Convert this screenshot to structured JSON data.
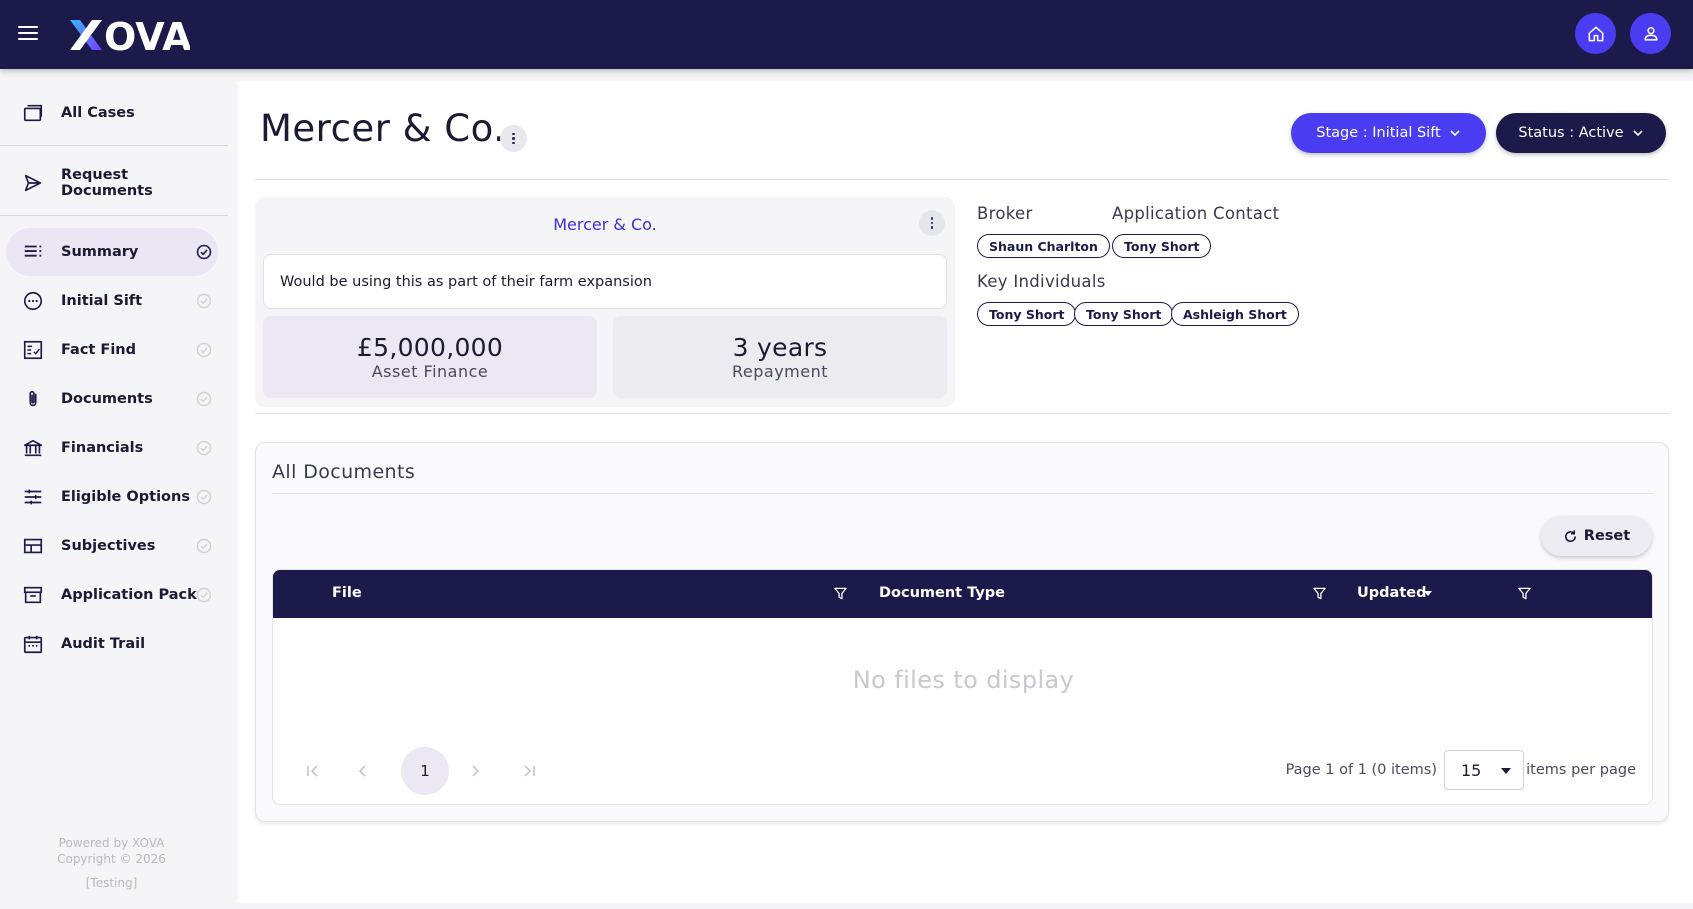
{
  "app": {
    "logo": "XOVA"
  },
  "sidebar": {
    "top_items": [
      {
        "label": "All Cases",
        "icon": "cases-icon"
      },
      {
        "label": "Request Documents",
        "icon": "send-icon"
      }
    ],
    "items": [
      {
        "label": "Summary",
        "icon": "summary-list-icon",
        "active": true,
        "completed": true
      },
      {
        "label": "Initial Sift",
        "icon": "dots-circle-icon"
      },
      {
        "label": "Fact Find",
        "icon": "checklist-icon"
      },
      {
        "label": "Documents",
        "icon": "paperclip-icon"
      },
      {
        "label": "Financials",
        "icon": "bank-icon"
      },
      {
        "label": "Eligible Options",
        "icon": "sliders-icon"
      },
      {
        "label": "Subjectives",
        "icon": "table-layout-icon"
      },
      {
        "label": "Application Pack",
        "icon": "archive-box-icon"
      },
      {
        "label": "Audit Trail",
        "icon": "calendar-icon"
      }
    ],
    "footer": {
      "powered_by": "Powered by XOVA",
      "copyright": "Copyright © 2026",
      "env": "[Testing]"
    }
  },
  "header": {
    "title": "Mercer & Co.",
    "stage_button": "Stage : Initial Sift",
    "status_button": "Status : Active"
  },
  "summary_card": {
    "title": "Mercer & Co.",
    "description": "Would be using this as part of their farm expansion",
    "amount_value": "£5,000,000",
    "amount_label": "Asset Finance",
    "term_value": "3 years",
    "term_label": "Repayment"
  },
  "people": {
    "broker_label": "Broker",
    "broker": "Shaun Charlton",
    "contact_label": "Application Contact",
    "contact": "Tony Short",
    "key_individuals_label": "Key Individuals",
    "key_individuals": [
      "Tony Short",
      "Tony Short",
      "Ashleigh Short"
    ]
  },
  "documents": {
    "title": "All Documents",
    "reset_label": "Reset",
    "columns": [
      "File",
      "Document Type",
      "Updated"
    ],
    "empty_message": "No files to display",
    "current_page": "1",
    "page_info": "Page 1 of 1 (0 items)",
    "per_page": "15",
    "per_page_label": "items per page"
  },
  "colors": {
    "navy": "#1c1a4a",
    "accent": "#4a3cf0",
    "active_bg": "#ebe6f4"
  }
}
